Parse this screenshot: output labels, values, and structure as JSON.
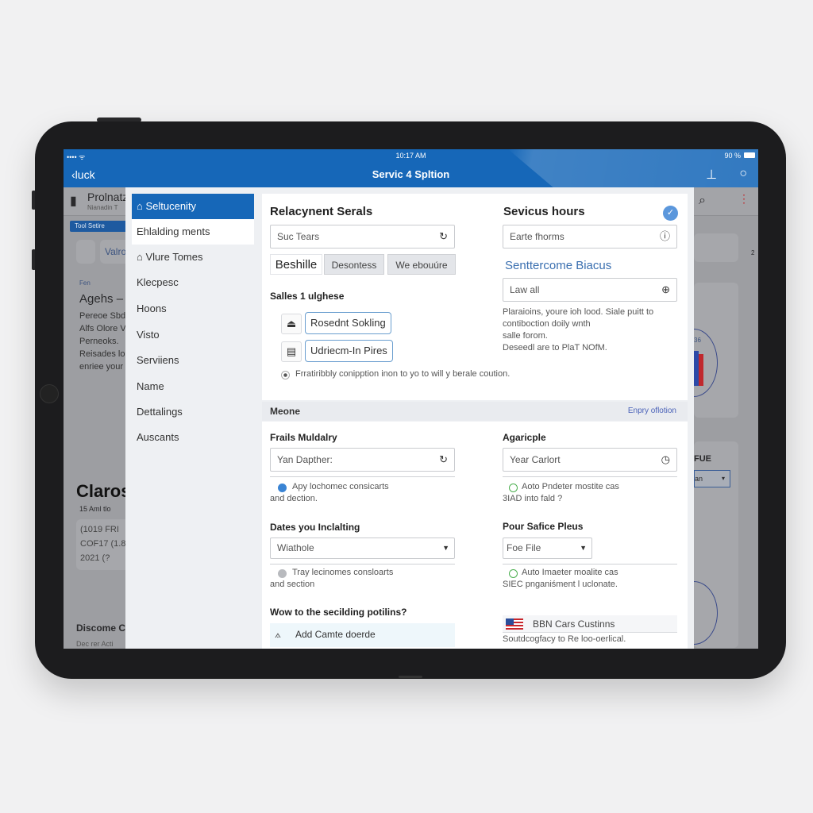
{
  "status_bar": {
    "time": "10:17 AM",
    "battery_text": "90 %",
    "signal": "•••• ᯤ"
  },
  "nav_bar": {
    "back_label": "luck",
    "title": "Servic 4 Spltion"
  },
  "background_app": {
    "header_title": "Prolnatz",
    "header_subtitle": "Nianadin T",
    "tag_button": "Tool Setire",
    "value_label": "Valro",
    "small_label": "Fen",
    "section_title": "Agehs –",
    "body_lines": [
      "Pereoe Sbd",
      "Alfs Olore V",
      "Perneoks.",
      "Reisades lo",
      "enriee your"
    ],
    "big_title": "Claros",
    "big_subtitle": "15 Aml tlo",
    "data_lines": [
      "(1019 FRI",
      "COF17 (1.8",
      "2021 (?"
    ],
    "footer_title": "Discome C",
    "footer_sub": "Dec rer Acti",
    "right_label": "FUE",
    "right_select": "an",
    "chart_value": "36",
    "page_indicator": "2"
  },
  "sidebar": {
    "items": [
      {
        "label": "Seltucenity",
        "icon": "building-icon",
        "state": "active"
      },
      {
        "label": "Ehlalding ments",
        "state": "highlighted"
      },
      {
        "label": "Vlure Tomes",
        "icon": "home-icon"
      },
      {
        "label": "Klecpesc"
      },
      {
        "label": "Hoons"
      },
      {
        "label": "Visto"
      },
      {
        "label": "Serviiens"
      },
      {
        "label": "Name"
      },
      {
        "label": "Dettalings"
      },
      {
        "label": "Auscants"
      }
    ]
  },
  "replacement_section": {
    "title": "Relacynent Serals",
    "search_value": "Suc Tears",
    "tabs": [
      "Beshille",
      "Desontess",
      "We ebouúre"
    ],
    "subheading": "Salles 1 ulghese",
    "chips": [
      {
        "label": "Rosednt Sokling",
        "icon": "upload-tray-icon"
      },
      {
        "label": "Udriecm-In Pires",
        "icon": "clipboard-icon"
      }
    ],
    "radio_note": "Frratiribbly conipption inon to yo to will y berale coution."
  },
  "service_hours": {
    "title": "Sevicus hours",
    "field_value": "Earte fhorms",
    "link_heading": "Senttercome Biacus",
    "field2_value": "Law all",
    "description_lines": [
      "Plaraioins, youre ioh lood. Siale puitt to",
      "contiboction doily wnth",
      "salle forom.",
      "Deseedl are to PlaT NOfM."
    ]
  },
  "meone_section": {
    "header": "Meone",
    "header_link": "Enpry oflotion",
    "left": {
      "label": "Frails Muldalry",
      "field_value": "Yan Dapther:",
      "note_lines": [
        "Apy lochomec consicarts",
        "and dection."
      ],
      "label2": "Dates you Inclalting",
      "select_value": "Wiathole",
      "note2_lines": [
        "Tray lecinomes consloarts",
        "and section"
      ],
      "question": "Wow to the secilding potilins?",
      "add_button": "Add Camte doerde"
    },
    "right": {
      "label": "Agaricple",
      "field_value": "Year Carlort",
      "note_lines": [
        "Aoto Pndeter mostite cas",
        "3IAD into fald ?"
      ],
      "label2": "Pour Safice Pleus",
      "select_value": "Foe File",
      "note2_lines": [
        "Auto Imaeter moalite cas",
        "SIEC pnganiśment l uclonate."
      ],
      "country_label": "BBN Cars Custinns",
      "country_note": "Soutdcogfacy to Re loo-oerlical."
    }
  },
  "colors": {
    "accent": "#1667b8",
    "chip_border": "#6a9ecf",
    "link": "#3a6fb0",
    "success": "#4caf50"
  }
}
